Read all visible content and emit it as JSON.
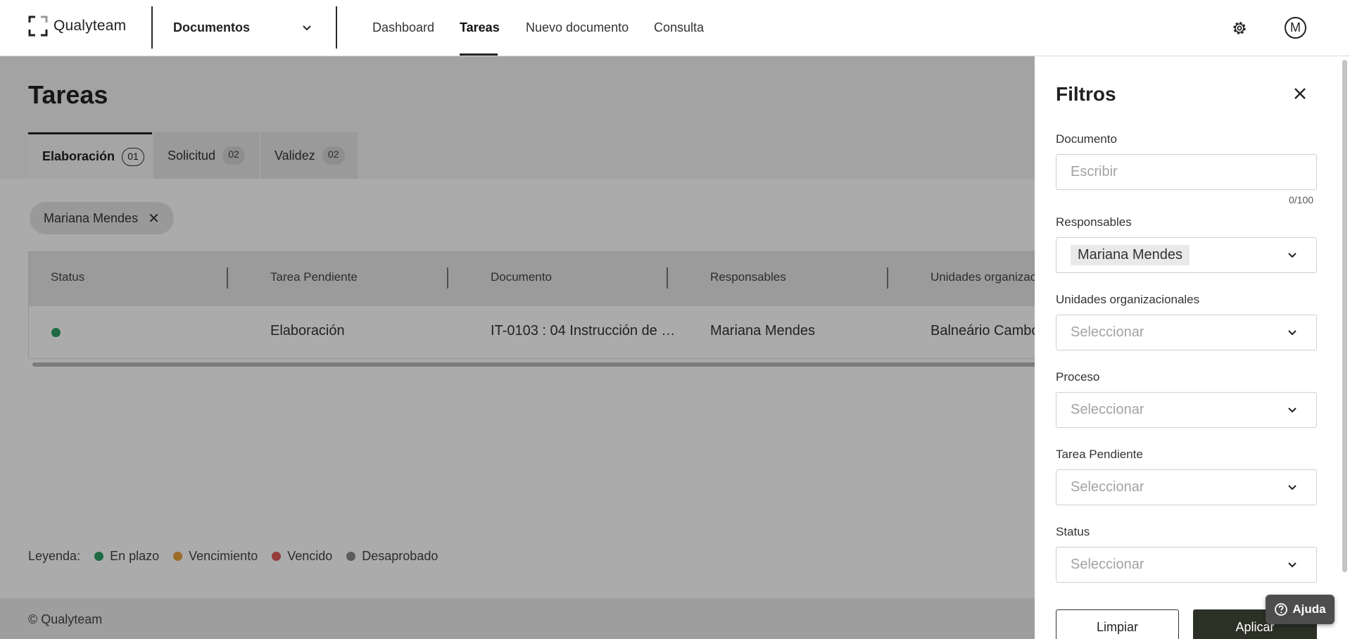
{
  "header": {
    "logo_text": "Qualyteam",
    "module_label": "Documentos",
    "nav": [
      "Dashboard",
      "Tareas",
      "Nuevo documento",
      "Consulta"
    ],
    "active_nav": "Tareas",
    "avatar_initial": "M"
  },
  "page": {
    "title": "Tareas",
    "tabs": [
      {
        "label": "Elaboración",
        "count": "01",
        "active": true
      },
      {
        "label": "Solicitud",
        "count": "02",
        "active": false
      },
      {
        "label": "Validez",
        "count": "02",
        "active": false
      }
    ],
    "active_filter_chip": "Mariana Mendes",
    "table": {
      "columns": [
        "Status",
        "Tarea Pendiente",
        "Documento",
        "Responsables",
        "Unidades organizac"
      ],
      "rows": [
        {
          "status_color": "#2e9e68",
          "tarea": "Elaboración",
          "documento": "IT-0103 : 04 Instrucción de …",
          "responsables": "Mariana Mendes",
          "unidades": "Balneário Cambo"
        }
      ]
    },
    "legend": {
      "label": "Leyenda:",
      "items": [
        {
          "label": "En plazo",
          "color": "#2e9e68"
        },
        {
          "label": "Vencimiento",
          "color": "#e8a33c"
        },
        {
          "label": "Vencido",
          "color": "#e05a5a"
        },
        {
          "label": "Desaprobado",
          "color": "#8a8a8a"
        }
      ]
    },
    "footer": "© Qualyteam"
  },
  "filters": {
    "title": "Filtros",
    "documento_label": "Documento",
    "documento_placeholder": "Escribir",
    "documento_counter": "0/100",
    "responsables_label": "Responsables",
    "responsables_value": "Mariana Mendes",
    "unidades_label": "Unidades organizacionales",
    "unidades_placeholder": "Seleccionar",
    "proceso_label": "Proceso",
    "proceso_placeholder": "Seleccionar",
    "tarea_label": "Tarea Pendiente",
    "tarea_placeholder": "Seleccionar",
    "status_label": "Status",
    "status_placeholder": "Seleccionar",
    "limpiar": "Limpiar",
    "aplicar": "Aplicar"
  },
  "help": {
    "label": "Ajuda"
  }
}
